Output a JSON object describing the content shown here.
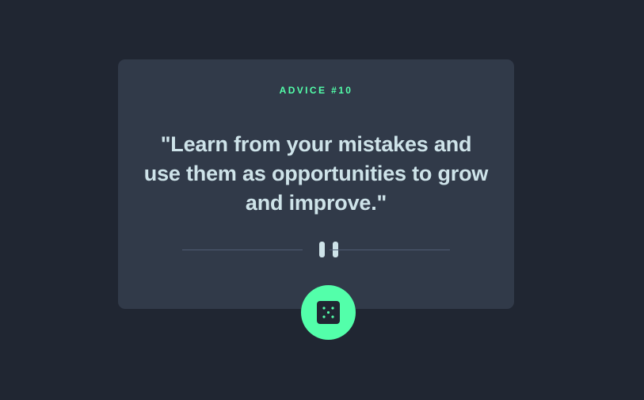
{
  "card": {
    "advice_label": "ADVICE #10",
    "quote": "\"Learn from your mistakes and use them as opportunities to grow and improve.\""
  },
  "icons": {
    "divider": "pause-icon",
    "button": "dice-icon"
  },
  "colors": {
    "background": "#202632",
    "card": "#313a49",
    "accent": "#53ffaa",
    "text": "#cee3e9",
    "divider": "#4f5d74"
  }
}
